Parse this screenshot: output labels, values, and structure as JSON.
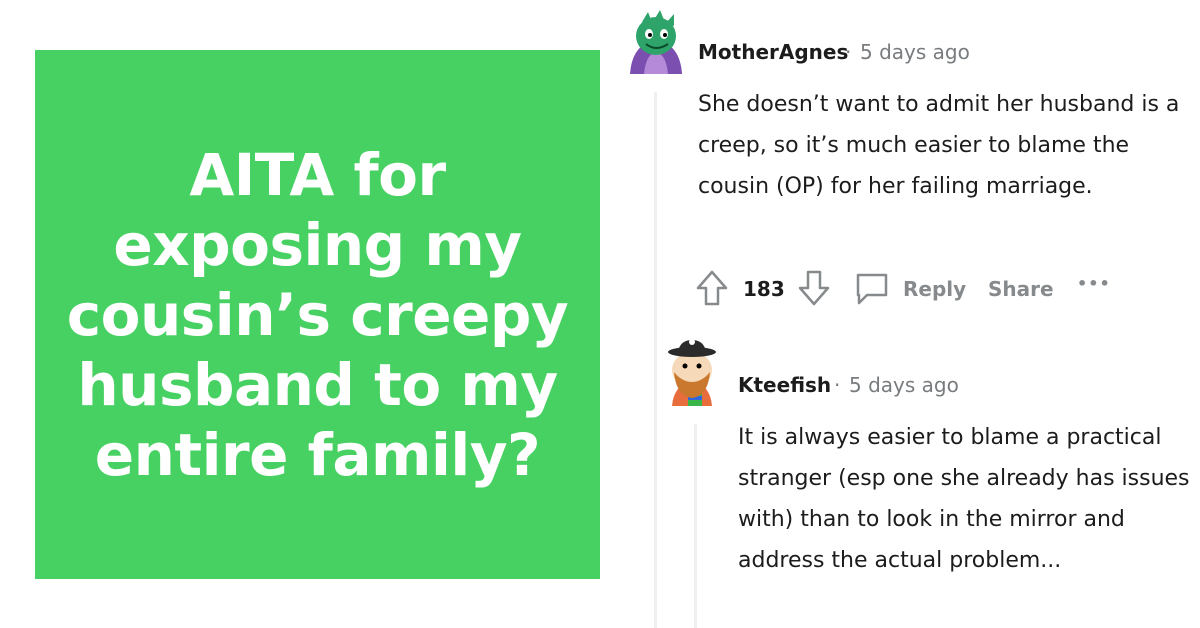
{
  "headline": {
    "text": "AITA for exposing my cousin’s creepy husband to my entire family?",
    "background": "#48d163",
    "color": "#ffffff"
  },
  "comments": [
    {
      "username": "MotherAgnes",
      "separator": "·",
      "timestamp": "5 days ago",
      "body": "She doesn’t want to admit her husband is a creep, so it’s much easier to blame the cousin (OP) for her failing marriage.",
      "score": "183",
      "actions": {
        "reply": "Reply",
        "share": "Share",
        "more": "•••"
      },
      "avatar_icon": "snoo-avatar-green-dragon-icon"
    },
    {
      "username": "Kteefish",
      "separator": "·",
      "timestamp": "5 days ago",
      "body": "It is always easier to blame a practical stranger (esp one she already has issues with) than to look in the mirror and address the actual problem...",
      "avatar_icon": "snoo-avatar-bearded-hat-icon"
    }
  ],
  "colors": {
    "text": "#1c1c1c",
    "meta": "#787c7e",
    "action": "#878a8c",
    "thread": "#edeff1"
  }
}
